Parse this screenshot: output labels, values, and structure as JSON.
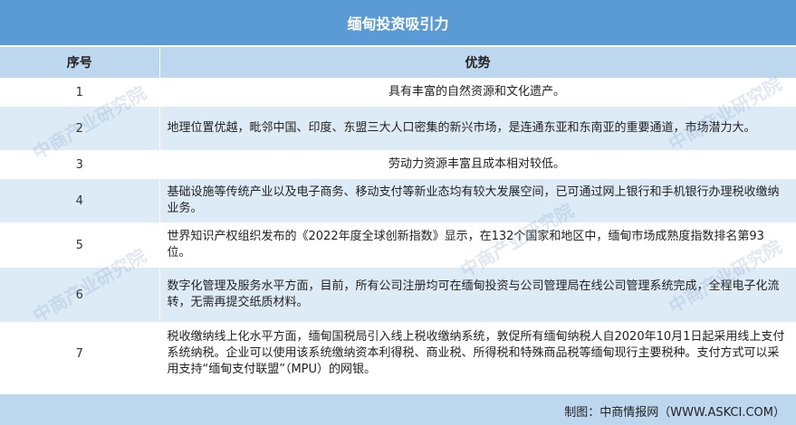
{
  "title": "缅甸投资吸引力",
  "headers": {
    "num": "序号",
    "adv": "优势"
  },
  "rows": [
    {
      "num": "1",
      "text": "具有丰富的自然资源和文化遗产。"
    },
    {
      "num": "2",
      "text": "地理位置优越，毗邻中国、印度、东盟三大人口密集的新兴市场，是连通东亚和东南亚的重要通道，市场潜力大。"
    },
    {
      "num": "3",
      "text": "劳动力资源丰富且成本相对较低。"
    },
    {
      "num": "4",
      "text": "基础设施等传统产业以及电子商务、移动支付等新业态均有较大发展空间，已可通过网上银行和手机银行办理税收缴纳业务。"
    },
    {
      "num": "5",
      "text": "世界知识产权组织发布的《2022年度全球创新指数》显示，在132个国家和地区中，缅甸市场成熟度指数排名第93位。"
    },
    {
      "num": "6",
      "text": "数字化管理及服务水平方面，目前，所有公司注册均可在缅甸投资与公司管理局在线公司管理系统完成，全程电子化流转，无需再提交纸质材料。"
    },
    {
      "num": "7",
      "text": "税收缴纳线上化水平方面，缅甸国税局引入线上税收缴纳系统，敦促所有缅甸纳税人自2020年10月1日起采用线上支付系统纳税。企业可以使用该系统缴纳资本利得税、商业税、所得税和特殊商品税等缅甸现行主要税种。支付方式可以采用支持“缅甸支付联盟”（MPU）的网银。"
    }
  ],
  "footer": "制图：中商情报网（WWW.ASKCI.COM）",
  "watermark": "中商产业研究院"
}
